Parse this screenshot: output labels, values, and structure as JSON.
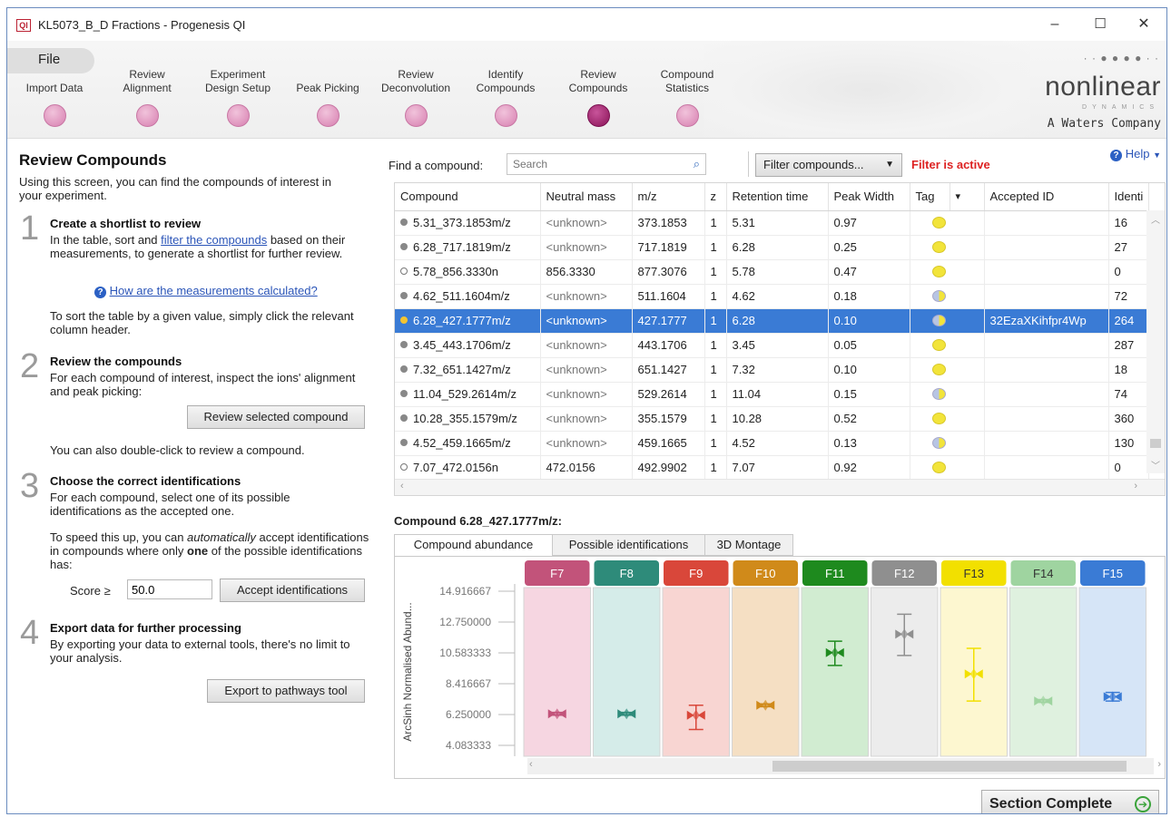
{
  "window": {
    "title": "KL5073_B_D Fractions - Progenesis QI",
    "app_icon": "QI",
    "controls": {
      "minimize": "–",
      "maximize": "☐",
      "close": "✕"
    }
  },
  "ribbon": {
    "file_label": "File",
    "steps": [
      {
        "label": "Import Data",
        "active": false
      },
      {
        "label": "Review\nAlignment",
        "active": false
      },
      {
        "label": "Experiment\nDesign Setup",
        "active": false
      },
      {
        "label": "Peak Picking",
        "active": false
      },
      {
        "label": "Review\nDeconvolution",
        "active": false
      },
      {
        "label": "Identify\nCompounds",
        "active": false
      },
      {
        "label": "Review\nCompounds",
        "active": true
      },
      {
        "label": "Compound\nStatistics",
        "active": false
      }
    ],
    "brand": {
      "name": "nonlinear",
      "sub": "DYNAMICS",
      "company": "A Waters Company"
    }
  },
  "left": {
    "title": "Review Compounds",
    "intro": "Using this screen, you can find the compounds of interest in your experiment.",
    "s1_num": "1",
    "s1_title": "Create a shortlist to review",
    "s1_text_a": "In the table, sort and ",
    "s1_link": "filter the compounds",
    "s1_text_b": " based on their measurements, to generate a shortlist for further review.",
    "s1_help_link": "How are the measurements calculated?",
    "s1_sort": "To sort the table by a given value, simply click the relevant column header.",
    "s2_num": "2",
    "s2_title": "Review the compounds",
    "s2_text": "For each compound of interest, inspect the ions' alignment and peak picking:",
    "s2_button": "Review selected compound",
    "s2_dbl": "You can also double-click to review a compound.",
    "s3_num": "3",
    "s3_title": "Choose the correct identifications",
    "s3_text": "For each compound, select one of its possible identifications as the accepted one.",
    "s3_speed_a": "To speed this up, you can ",
    "s3_speed_em": "automatically",
    "s3_speed_b": " accept identifications in compounds where only ",
    "s3_speed_bold": "one",
    "s3_speed_c": " of the possible identifications has:",
    "score_label": "Score ≥",
    "score_value": "50.0",
    "s3_button": "Accept identifications",
    "s4_num": "4",
    "s4_title": "Export data for further processing",
    "s4_text": "By exporting your data to external tools, there's no limit to your analysis.",
    "s4_button": "Export to pathways tool"
  },
  "toolbar": {
    "find_label": "Find a compound:",
    "search_placeholder": "Search",
    "filter_label": "Filter compounds...",
    "filter_status": "Filter is active",
    "help_label": "Help"
  },
  "table": {
    "columns": [
      "Compound",
      "Neutral mass",
      "m/z",
      "z",
      "Retention time",
      "Peak Width",
      "Tag",
      "",
      "Accepted ID",
      "Identi"
    ],
    "rows": [
      {
        "compound": "5.31_373.1853m/z",
        "neutral_mass": "<unknown>",
        "mz": "373.1853",
        "z": "1",
        "rt": "5.31",
        "pw": "0.97",
        "tag": "yellow",
        "accepted": "",
        "ident": "16",
        "dot": "grey",
        "selected": false
      },
      {
        "compound": "6.28_717.1819m/z",
        "neutral_mass": "<unknown>",
        "mz": "717.1819",
        "z": "1",
        "rt": "6.28",
        "pw": "0.25",
        "tag": "yellow",
        "accepted": "",
        "ident": "27",
        "dot": "grey",
        "selected": false
      },
      {
        "compound": "5.78_856.3330n",
        "neutral_mass": "856.3330",
        "mz": "877.3076",
        "z": "1",
        "rt": "5.78",
        "pw": "0.47",
        "tag": "yellow",
        "accepted": "",
        "ident": "0",
        "dot": "open",
        "selected": false
      },
      {
        "compound": "4.62_511.1604m/z",
        "neutral_mass": "<unknown>",
        "mz": "511.1604",
        "z": "1",
        "rt": "4.62",
        "pw": "0.18",
        "tag": "split",
        "accepted": "",
        "ident": "72",
        "dot": "grey",
        "selected": false
      },
      {
        "compound": "6.28_427.1777m/z",
        "neutral_mass": "<unknown>",
        "mz": "427.1777",
        "z": "1",
        "rt": "6.28",
        "pw": "0.10",
        "tag": "split",
        "accepted": "32EzaXKihfpr4Wp",
        "ident": "264",
        "dot": "gold",
        "selected": true
      },
      {
        "compound": "3.45_443.1706m/z",
        "neutral_mass": "<unknown>",
        "mz": "443.1706",
        "z": "1",
        "rt": "3.45",
        "pw": "0.05",
        "tag": "yellow",
        "accepted": "",
        "ident": "287",
        "dot": "grey",
        "selected": false
      },
      {
        "compound": "7.32_651.1427m/z",
        "neutral_mass": "<unknown>",
        "mz": "651.1427",
        "z": "1",
        "rt": "7.32",
        "pw": "0.10",
        "tag": "yellow",
        "accepted": "",
        "ident": "18",
        "dot": "grey",
        "selected": false
      },
      {
        "compound": "11.04_529.2614m/z",
        "neutral_mass": "<unknown>",
        "mz": "529.2614",
        "z": "1",
        "rt": "11.04",
        "pw": "0.15",
        "tag": "split",
        "accepted": "",
        "ident": "74",
        "dot": "grey",
        "selected": false
      },
      {
        "compound": "10.28_355.1579m/z",
        "neutral_mass": "<unknown>",
        "mz": "355.1579",
        "z": "1",
        "rt": "10.28",
        "pw": "0.52",
        "tag": "yellow",
        "accepted": "",
        "ident": "360",
        "dot": "grey",
        "selected": false
      },
      {
        "compound": "4.52_459.1665m/z",
        "neutral_mass": "<unknown>",
        "mz": "459.1665",
        "z": "1",
        "rt": "4.52",
        "pw": "0.13",
        "tag": "split",
        "accepted": "",
        "ident": "130",
        "dot": "grey",
        "selected": false
      },
      {
        "compound": "7.07_472.0156n",
        "neutral_mass": "472.0156",
        "mz": "492.9902",
        "z": "1",
        "rt": "7.07",
        "pw": "0.92",
        "tag": "yellow",
        "accepted": "",
        "ident": "0",
        "dot": "open",
        "selected": false
      }
    ]
  },
  "detail": {
    "title": "Compound 6.28_427.1777m/z:",
    "tabs": [
      {
        "label": "Compound abundance",
        "active": true
      },
      {
        "label": "Possible identifications",
        "active": false
      },
      {
        "label": "3D Montage",
        "active": false
      }
    ]
  },
  "chart_data": {
    "type": "scatter",
    "ylabel": "ArcSinh Normalised Abund...",
    "yticks": [
      "14.916667",
      "12.750000",
      "10.583333",
      "8.416667",
      "6.250000",
      "4.083333"
    ],
    "ylim": [
      4.083333,
      14.916667
    ],
    "categories": [
      "F7",
      "F8",
      "F9",
      "F10",
      "F11",
      "F12",
      "F13",
      "F14",
      "F15"
    ],
    "colors": [
      "#c2537a",
      "#2e8b7a",
      "#d9473a",
      "#d08a1a",
      "#1e8a1e",
      "#8f8f8f",
      "#f2e000",
      "#9fd4a0",
      "#3a7bd5"
    ],
    "fills": [
      "#f6d6e1",
      "#d5ece9",
      "#f8d5d2",
      "#f5dfc3",
      "#d1ecd1",
      "#ececec",
      "#fdf7d0",
      "#dff1df",
      "#d6e5f7"
    ],
    "series": [
      {
        "name": "F7",
        "mean": 6.3,
        "low": 6.2,
        "high": 6.4
      },
      {
        "name": "F8",
        "mean": 6.3,
        "low": 6.2,
        "high": 6.4
      },
      {
        "name": "F9",
        "mean": 6.2,
        "low": 5.2,
        "high": 6.9
      },
      {
        "name": "F10",
        "mean": 6.9,
        "low": 6.8,
        "high": 7.0
      },
      {
        "name": "F11",
        "mean": 10.6,
        "low": 9.7,
        "high": 11.4
      },
      {
        "name": "F12",
        "mean": 11.9,
        "low": 10.4,
        "high": 13.3
      },
      {
        "name": "F13",
        "mean": 9.1,
        "low": 7.2,
        "high": 10.9
      },
      {
        "name": "F14",
        "mean": 7.2,
        "low": 7.1,
        "high": 7.3
      },
      {
        "name": "F15",
        "mean": 7.5,
        "low": 7.2,
        "high": 7.8
      }
    ]
  },
  "footer": {
    "section_complete": "Section Complete"
  }
}
